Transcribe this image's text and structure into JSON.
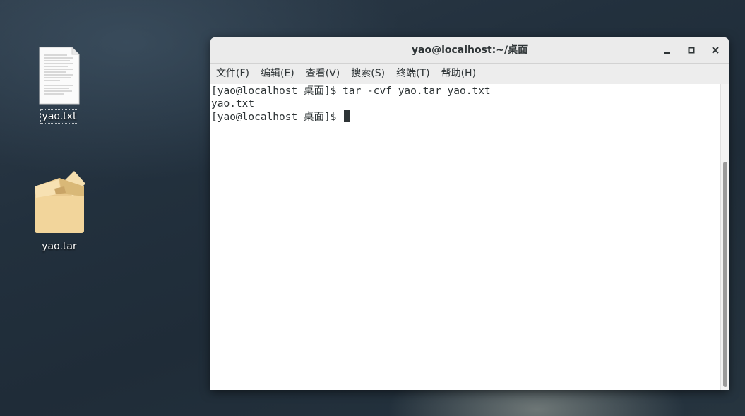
{
  "desktop": {
    "icons": [
      {
        "label": "yao.txt",
        "icon": "text-file-icon"
      },
      {
        "label": "yao.tar",
        "icon": "archive-box-icon"
      }
    ]
  },
  "window": {
    "title": "yao@localhost:~/桌面",
    "controls": {
      "minimize": "minimize-icon",
      "maximize": "maximize-icon",
      "close": "close-icon"
    }
  },
  "menu": {
    "items": [
      "文件(F)",
      "编辑(E)",
      "查看(V)",
      "搜索(S)",
      "终端(T)",
      "帮助(H)"
    ]
  },
  "terminal": {
    "lines": [
      "[yao@localhost 桌面]$ tar -cvf yao.tar yao.txt",
      "yao.txt",
      "[yao@localhost 桌面]$ "
    ]
  },
  "colors": {
    "terminal_bg": "#ffffff",
    "terminal_fg": "#2e3436",
    "titlebar_bg": "#ebebeb"
  }
}
